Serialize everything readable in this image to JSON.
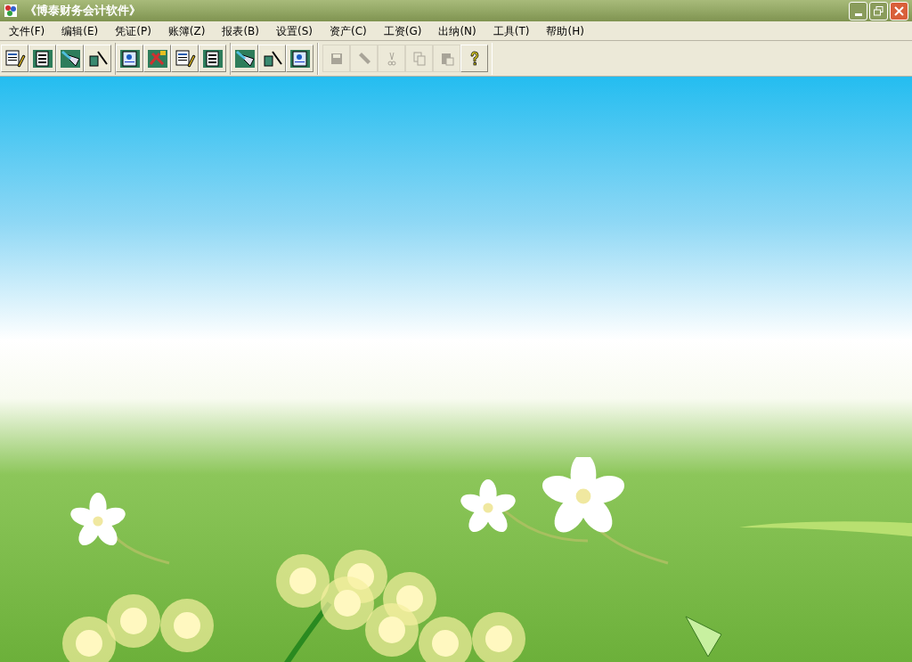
{
  "window": {
    "title": "《博泰财务会计软件》"
  },
  "menu": [
    "文件(F)",
    "编辑(E)",
    "凭证(P)",
    "账簿(Z)",
    "报表(B)",
    "设置(S)",
    "资产(C)",
    "工资(G)",
    "出纳(N)",
    "工具(T)",
    "帮助(H)"
  ],
  "toolbar": {
    "groups": [
      [
        {
          "disabled": false
        },
        {
          "disabled": false
        },
        {
          "disabled": false
        },
        {
          "disabled": false
        }
      ],
      [
        {
          "disabled": false
        },
        {
          "disabled": false
        },
        {
          "disabled": false
        },
        {
          "disabled": false
        }
      ],
      [
        {
          "disabled": false
        },
        {
          "disabled": false
        },
        {
          "disabled": false
        }
      ],
      [
        {
          "disabled": true
        },
        {
          "disabled": true
        },
        {
          "disabled": true
        },
        {
          "disabled": true
        },
        {
          "disabled": true
        },
        {
          "disabled": false
        }
      ]
    ]
  }
}
